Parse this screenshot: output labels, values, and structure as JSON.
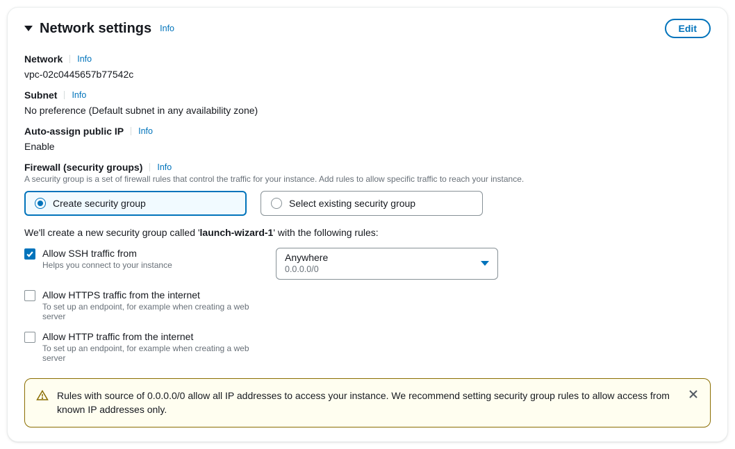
{
  "header": {
    "title": "Network settings",
    "info": "Info",
    "edit": "Edit"
  },
  "network": {
    "label": "Network",
    "info": "Info",
    "value": "vpc-02c0445657b77542c"
  },
  "subnet": {
    "label": "Subnet",
    "info": "Info",
    "value": "No preference (Default subnet in any availability zone)"
  },
  "auto_ip": {
    "label": "Auto-assign public IP",
    "info": "Info",
    "value": "Enable"
  },
  "firewall": {
    "label": "Firewall (security groups)",
    "info": "Info",
    "help": "A security group is a set of firewall rules that control the traffic for your instance. Add rules to allow specific traffic to reach your instance.",
    "options": {
      "create": "Create security group",
      "select": "Select existing security group"
    },
    "note_pre": "We'll create a new security group called '",
    "note_name": "launch-wizard-1",
    "note_post": "' with the following rules:"
  },
  "rules": {
    "ssh": {
      "label": "Allow SSH traffic from",
      "help": "Helps you connect to your instance",
      "checked": true,
      "source": {
        "main": "Anywhere",
        "sub": "0.0.0.0/0"
      }
    },
    "https": {
      "label": "Allow HTTPS traffic from the internet",
      "help": "To set up an endpoint, for example when creating a web server",
      "checked": false
    },
    "http": {
      "label": "Allow HTTP traffic from the internet",
      "help": "To set up an endpoint, for example when creating a web server",
      "checked": false
    }
  },
  "alert": {
    "text": "Rules with source of 0.0.0.0/0 allow all IP addresses to access your instance. We recommend setting security group rules to allow access from known IP addresses only."
  }
}
